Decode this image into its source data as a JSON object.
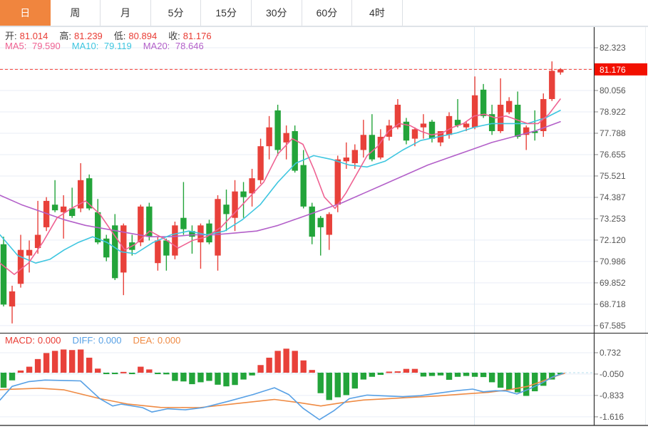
{
  "tabs": {
    "items": [
      {
        "name": "day",
        "label": "日",
        "active": true
      },
      {
        "name": "week",
        "label": "周",
        "active": false
      },
      {
        "name": "month",
        "label": "月",
        "active": false
      },
      {
        "name": "5min",
        "label": "5分",
        "active": false
      },
      {
        "name": "15min",
        "label": "15分",
        "active": false
      },
      {
        "name": "30min",
        "label": "30分",
        "active": false
      },
      {
        "name": "60min",
        "label": "60分",
        "active": false
      },
      {
        "name": "4hour",
        "label": "4时",
        "active": false
      }
    ],
    "active_bg": "#f0853e"
  },
  "quote": {
    "items": [
      {
        "label": "开:",
        "value": "81.014"
      },
      {
        "label": "高:",
        "value": "81.239"
      },
      {
        "label": "低:",
        "value": "80.894"
      },
      {
        "label": "收:",
        "value": "81.176"
      }
    ],
    "label_color": "#3c3c3c",
    "value_color": "#e93c34"
  },
  "ma_legend": [
    {
      "label": "MA5:",
      "value": "79.590",
      "color": "#ef6292"
    },
    {
      "label": "MA10:",
      "value": "79.119",
      "color": "#3ec6e0"
    },
    {
      "label": "MA20:",
      "value": "78.646",
      "color": "#b360c9"
    }
  ],
  "macd_legend": [
    {
      "label": "MACD:",
      "value": "0.000",
      "color": "#e93c34"
    },
    {
      "label": "DIFF:",
      "value": "0.000",
      "color": "#57a0e5"
    },
    {
      "label": "DEA:",
      "value": "0.000",
      "color": "#ef8b44"
    }
  ],
  "colors": {
    "up": "#e8413a",
    "down": "#23a43a",
    "grid": "#e9eef6",
    "axis": "#2f2f2f",
    "tick": "#888",
    "label": "#555",
    "price_line": "#f43b30",
    "price_box": "#f21000",
    "price_box_text": "#ffffff",
    "zero_line": "#b5dfee",
    "vgrid": "#dde8f0",
    "panel_border": "#222222",
    "top_border": "#dfe3e8",
    "ma5": "#ef6292",
    "ma10": "#3ec6e0",
    "ma20": "#b360c9",
    "diff": "#57a0e5",
    "dea": "#ef8b44"
  },
  "chart_data": {
    "type": "candlestick+macd",
    "title": "",
    "main": {
      "ylim": [
        67.585,
        82.323
      ],
      "axis_ticks": [
        82.323,
        80.056,
        78.922,
        77.788,
        76.655,
        75.521,
        74.387,
        73.253,
        72.12,
        70.986,
        69.852,
        68.718,
        67.585
      ],
      "hidden_grid_tick": 81.189,
      "price_line": 81.176,
      "candles_ohlc": [
        [
          71.9,
          72.3,
          68.6,
          68.7
        ],
        [
          68.6,
          69.7,
          67.7,
          69.4
        ],
        [
          69.8,
          72.4,
          69.6,
          71.6
        ],
        [
          71.3,
          72.1,
          70.4,
          71.6
        ],
        [
          71.7,
          74.2,
          71.4,
          72.4
        ],
        [
          72.8,
          74.4,
          72.6,
          74.2
        ],
        [
          74.0,
          75.3,
          73.6,
          73.7
        ],
        [
          73.6,
          74.5,
          72.2,
          73.9
        ],
        [
          73.8,
          74.9,
          73.3,
          73.4
        ],
        [
          73.8,
          76.2,
          73.6,
          75.3
        ],
        [
          75.4,
          75.6,
          73.7,
          73.8
        ],
        [
          73.6,
          74.3,
          71.9,
          72.0
        ],
        [
          72.2,
          72.4,
          71.0,
          71.2
        ],
        [
          72.9,
          73.5,
          70.0,
          70.1
        ],
        [
          70.4,
          73.0,
          69.2,
          72.9
        ],
        [
          72.0,
          72.4,
          71.3,
          71.6
        ],
        [
          72.0,
          74.0,
          71.8,
          73.9
        ],
        [
          73.9,
          74.1,
          72.1,
          72.3
        ],
        [
          70.9,
          72.3,
          70.5,
          72.1
        ],
        [
          72.1,
          72.2,
          70.5,
          71.3
        ],
        [
          71.3,
          73.1,
          71.1,
          72.9
        ],
        [
          73.3,
          75.2,
          72.4,
          72.7
        ],
        [
          72.6,
          72.9,
          71.4,
          72.3
        ],
        [
          72.0,
          73.0,
          70.6,
          72.9
        ],
        [
          73.0,
          73.2,
          71.9,
          72.0
        ],
        [
          71.3,
          74.5,
          70.5,
          74.3
        ],
        [
          74.0,
          74.8,
          72.6,
          73.5
        ],
        [
          73.3,
          75.3,
          72.6,
          74.7
        ],
        [
          74.7,
          75.2,
          73.3,
          74.4
        ],
        [
          74.6,
          75.9,
          73.9,
          75.4
        ],
        [
          75.3,
          77.5,
          75.1,
          77.1
        ],
        [
          77.1,
          78.7,
          76.4,
          78.1
        ],
        [
          79.0,
          79.3,
          76.6,
          76.9
        ],
        [
          77.3,
          78.2,
          76.4,
          77.8
        ],
        [
          77.9,
          78.2,
          75.7,
          75.8
        ],
        [
          76.1,
          76.9,
          73.8,
          73.9
        ],
        [
          73.9,
          74.1,
          71.9,
          72.3
        ],
        [
          73.3,
          73.4,
          71.3,
          72.8
        ],
        [
          72.4,
          73.6,
          71.6,
          73.5
        ],
        [
          74.0,
          76.6,
          73.6,
          76.4
        ],
        [
          76.3,
          77.3,
          75.9,
          76.5
        ],
        [
          76.2,
          77.2,
          75.9,
          76.9
        ],
        [
          76.9,
          78.5,
          76.5,
          77.7
        ],
        [
          77.7,
          78.8,
          76.3,
          76.4
        ],
        [
          76.5,
          78.0,
          76.4,
          77.6
        ],
        [
          77.6,
          78.5,
          77.4,
          78.2
        ],
        [
          78.1,
          79.6,
          78.0,
          79.3
        ],
        [
          78.4,
          78.6,
          77.2,
          77.4
        ],
        [
          77.5,
          78.1,
          77.1,
          78.0
        ],
        [
          78.1,
          78.8,
          77.5,
          78.3
        ],
        [
          78.4,
          78.5,
          77.3,
          77.5
        ],
        [
          77.3,
          77.9,
          77.1,
          77.9
        ],
        [
          77.7,
          78.9,
          77.5,
          78.7
        ],
        [
          78.5,
          79.6,
          78.1,
          78.2
        ],
        [
          78.1,
          78.4,
          77.9,
          78.3
        ],
        [
          78.1,
          80.8,
          78.0,
          79.8
        ],
        [
          80.1,
          80.4,
          78.6,
          78.7
        ],
        [
          78.8,
          79.3,
          77.7,
          77.9
        ],
        [
          77.9,
          80.7,
          77.8,
          79.3
        ],
        [
          78.9,
          79.7,
          78.8,
          79.5
        ],
        [
          79.3,
          80.0,
          77.5,
          77.6
        ],
        [
          77.7,
          78.2,
          76.9,
          78.1
        ],
        [
          77.9,
          79.0,
          77.4,
          77.8
        ],
        [
          77.9,
          79.9,
          77.6,
          79.6
        ],
        [
          79.6,
          81.6,
          79.5,
          81.1
        ],
        [
          81.014,
          81.239,
          80.894,
          81.176
        ]
      ],
      "ma5": [
        [
          0,
          70.9
        ],
        [
          20,
          70.3
        ],
        [
          40,
          70.9
        ],
        [
          60,
          72.0
        ],
        [
          80,
          73.3
        ],
        [
          100,
          73.8
        ],
        [
          120,
          74.2
        ],
        [
          140,
          73.5
        ],
        [
          160,
          72.4
        ],
        [
          175,
          71.6
        ],
        [
          190,
          71.9
        ],
        [
          210,
          72.6
        ],
        [
          230,
          72.2
        ],
        [
          250,
          71.7
        ],
        [
          270,
          72.1
        ],
        [
          290,
          72.3
        ],
        [
          310,
          72.8
        ],
        [
          330,
          73.6
        ],
        [
          350,
          74.4
        ],
        [
          370,
          75.2
        ],
        [
          390,
          76.7
        ],
        [
          410,
          77.5
        ],
        [
          425,
          77.2
        ],
        [
          440,
          75.9
        ],
        [
          455,
          74.4
        ],
        [
          470,
          73.8
        ],
        [
          485,
          74.6
        ],
        [
          500,
          75.6
        ],
        [
          515,
          76.6
        ],
        [
          530,
          77.1
        ],
        [
          545,
          77.9
        ],
        [
          560,
          78.3
        ],
        [
          575,
          78.2
        ],
        [
          590,
          77.9
        ],
        [
          605,
          77.7
        ],
        [
          620,
          77.8
        ],
        [
          635,
          78.1
        ],
        [
          650,
          78.3
        ],
        [
          665,
          78.7
        ],
        [
          680,
          78.8
        ],
        [
          695,
          78.6
        ],
        [
          710,
          78.7
        ],
        [
          725,
          78.5
        ],
        [
          740,
          78.3
        ],
        [
          755,
          78.3
        ],
        [
          770,
          78.8
        ],
        [
          786,
          79.6
        ]
      ],
      "ma10": [
        [
          0,
          72.4
        ],
        [
          25,
          71.3
        ],
        [
          50,
          70.9
        ],
        [
          70,
          71.1
        ],
        [
          90,
          71.6
        ],
        [
          110,
          72.0
        ],
        [
          130,
          72.3
        ],
        [
          150,
          72.0
        ],
        [
          170,
          71.5
        ],
        [
          190,
          71.4
        ],
        [
          215,
          72.0
        ],
        [
          240,
          72.4
        ],
        [
          265,
          72.6
        ],
        [
          290,
          72.4
        ],
        [
          315,
          72.6
        ],
        [
          340,
          73.2
        ],
        [
          365,
          74.0
        ],
        [
          390,
          75.2
        ],
        [
          415,
          76.2
        ],
        [
          440,
          76.6
        ],
        [
          465,
          76.4
        ],
        [
          490,
          76.1
        ],
        [
          515,
          76.0
        ],
        [
          540,
          76.3
        ],
        [
          565,
          76.9
        ],
        [
          590,
          77.4
        ],
        [
          615,
          77.6
        ],
        [
          640,
          77.8
        ],
        [
          665,
          78.1
        ],
        [
          690,
          78.3
        ],
        [
          715,
          78.3
        ],
        [
          740,
          78.3
        ],
        [
          765,
          78.6
        ],
        [
          786,
          79.0
        ]
      ],
      "ma20": [
        [
          0,
          74.5
        ],
        [
          30,
          74.0
        ],
        [
          60,
          73.6
        ],
        [
          90,
          73.2
        ],
        [
          120,
          72.9
        ],
        [
          150,
          72.7
        ],
        [
          180,
          72.5
        ],
        [
          210,
          72.3
        ],
        [
          240,
          72.3
        ],
        [
          270,
          72.4
        ],
        [
          300,
          72.4
        ],
        [
          330,
          72.5
        ],
        [
          360,
          72.6
        ],
        [
          390,
          72.9
        ],
        [
          420,
          73.3
        ],
        [
          450,
          73.7
        ],
        [
          480,
          74.1
        ],
        [
          510,
          74.6
        ],
        [
          540,
          75.1
        ],
        [
          570,
          75.6
        ],
        [
          600,
          76.1
        ],
        [
          630,
          76.5
        ],
        [
          660,
          76.9
        ],
        [
          690,
          77.3
        ],
        [
          720,
          77.6
        ],
        [
          750,
          77.9
        ],
        [
          786,
          78.4
        ]
      ]
    },
    "macd": {
      "axis_ticks": [
        0.732,
        -0.05,
        -0.833,
        -1.616
      ],
      "zero": 0.0,
      "hist": [
        -0.55,
        -0.28,
        0.08,
        0.22,
        0.5,
        0.72,
        0.8,
        0.85,
        0.83,
        0.85,
        0.55,
        0.15,
        -0.03,
        -0.05,
        0.03,
        -0.03,
        0.22,
        0.12,
        -0.03,
        -0.06,
        -0.3,
        -0.32,
        -0.42,
        -0.35,
        -0.3,
        -0.44,
        -0.5,
        -0.45,
        -0.25,
        -0.1,
        0.28,
        0.55,
        0.8,
        0.88,
        0.8,
        0.45,
        0.1,
        -0.75,
        -1.0,
        -0.9,
        -0.82,
        -0.58,
        -0.25,
        -0.15,
        -0.08,
        0.04,
        0.05,
        0.14,
        0.14,
        -0.14,
        -0.12,
        -0.1,
        -0.26,
        -0.15,
        -0.12,
        -0.15,
        -0.16,
        -0.35,
        -0.55,
        -0.62,
        -0.72,
        -0.85,
        -0.68,
        -0.48,
        -0.25,
        -0.06
      ],
      "diff": [
        [
          0,
          -1.0
        ],
        [
          17,
          -0.5
        ],
        [
          40,
          -0.33
        ],
        [
          63,
          -0.27
        ],
        [
          95,
          -0.29
        ],
        [
          113,
          -0.3
        ],
        [
          140,
          -0.95
        ],
        [
          158,
          -1.22
        ],
        [
          170,
          -1.15
        ],
        [
          200,
          -1.28
        ],
        [
          213,
          -1.44
        ],
        [
          235,
          -1.32
        ],
        [
          260,
          -1.36
        ],
        [
          285,
          -1.28
        ],
        [
          320,
          -1.05
        ],
        [
          355,
          -0.8
        ],
        [
          385,
          -0.55
        ],
        [
          405,
          -0.8
        ],
        [
          425,
          -1.3
        ],
        [
          448,
          -1.72
        ],
        [
          468,
          -1.4
        ],
        [
          490,
          -0.95
        ],
        [
          515,
          -0.82
        ],
        [
          540,
          -0.85
        ],
        [
          565,
          -0.88
        ],
        [
          590,
          -0.84
        ],
        [
          615,
          -0.75
        ],
        [
          640,
          -0.66
        ],
        [
          663,
          -0.6
        ],
        [
          678,
          -0.7
        ],
        [
          695,
          -0.66
        ],
        [
          710,
          -0.67
        ],
        [
          725,
          -0.78
        ],
        [
          742,
          -0.6
        ],
        [
          760,
          -0.38
        ],
        [
          775,
          -0.16
        ],
        [
          790,
          -0.02
        ]
      ],
      "dea": [
        [
          0,
          -0.62
        ],
        [
          55,
          -0.57
        ],
        [
          90,
          -0.63
        ],
        [
          140,
          -0.95
        ],
        [
          180,
          -1.15
        ],
        [
          225,
          -1.27
        ],
        [
          280,
          -1.28
        ],
        [
          335,
          -1.12
        ],
        [
          385,
          -0.98
        ],
        [
          420,
          -1.1
        ],
        [
          450,
          -1.22
        ],
        [
          480,
          -1.1
        ],
        [
          510,
          -1.0
        ],
        [
          545,
          -0.95
        ],
        [
          580,
          -0.9
        ],
        [
          615,
          -0.85
        ],
        [
          650,
          -0.78
        ],
        [
          685,
          -0.72
        ],
        [
          715,
          -0.62
        ],
        [
          740,
          -0.5
        ],
        [
          760,
          -0.32
        ],
        [
          778,
          -0.14
        ],
        [
          792,
          -0.02
        ]
      ]
    }
  }
}
